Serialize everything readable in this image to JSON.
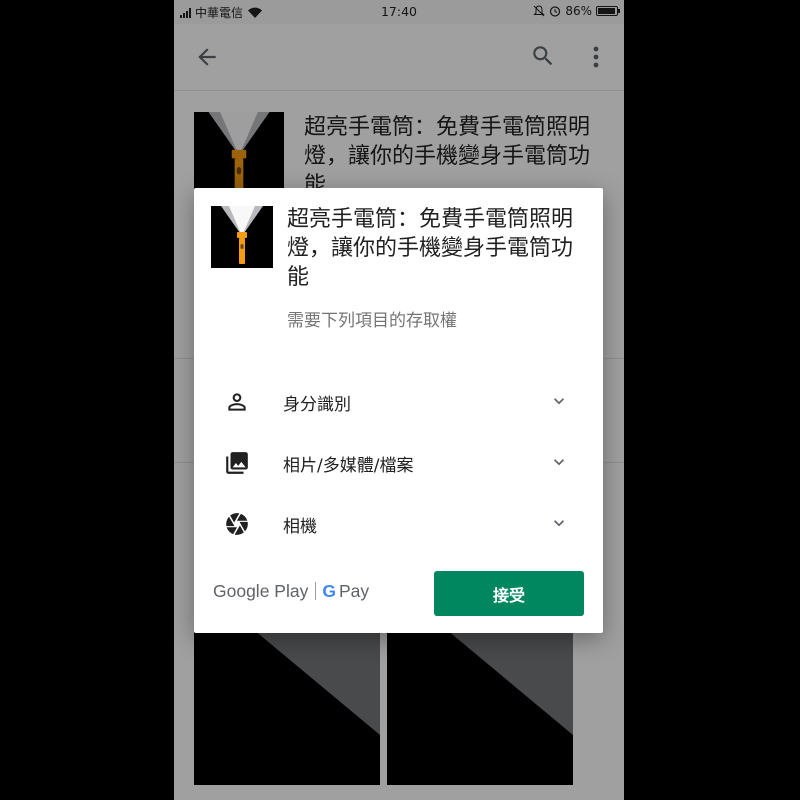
{
  "status_bar": {
    "carrier": "中華電信",
    "time": "17:40",
    "battery": "86%"
  },
  "app_bar": {
    "back_icon": "arrow-left-icon",
    "search_icon": "search-icon",
    "more_icon": "more-vert-icon"
  },
  "background": {
    "app_title": "超亮手電筒：免費手電筒照明燈，讓你的手機變身手電筒功能"
  },
  "dialog": {
    "app_title": "超亮手電筒：免費手電筒照明燈，讓你的手機變身手電筒功能",
    "subtitle": "需要下列項目的存取權",
    "permissions": [
      {
        "label": "身分識別",
        "icon": "person-icon"
      },
      {
        "label": "相片/多媒體/檔案",
        "icon": "photo-library-icon"
      },
      {
        "label": "相機",
        "icon": "camera-shutter-icon"
      }
    ],
    "brand_left": "Google Play",
    "brand_right": "Pay",
    "brand_g": "G",
    "accept_label": "接受"
  },
  "colors": {
    "accept_button": "#01875f",
    "flashlight_body": "#f39c12",
    "scrim": "rgba(0,0,0,0.36)"
  }
}
